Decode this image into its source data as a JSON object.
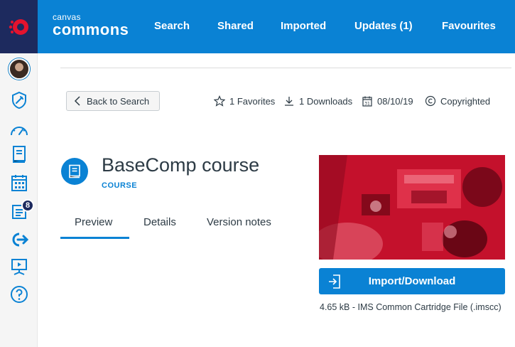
{
  "brand": {
    "small": "canvas",
    "big": "commons"
  },
  "nav": [
    {
      "label": "Search"
    },
    {
      "label": "Shared"
    },
    {
      "label": "Imported"
    },
    {
      "label": "Updates (1)"
    },
    {
      "label": "Favourites"
    }
  ],
  "sidebar": {
    "icons": [
      "avatar",
      "admin-icon",
      "dashboard-icon",
      "courses-icon",
      "calendar-icon",
      "inbox-icon",
      "commons-icon",
      "studio-icon",
      "help-icon"
    ],
    "inbox_badge": "8"
  },
  "back_button": {
    "label": "Back to Search"
  },
  "meta": {
    "favorites": "1 Favorites",
    "downloads": "1 Downloads",
    "date": "08/10/19",
    "license": "Copyrighted"
  },
  "resource": {
    "title": "BaseComp course",
    "type": "COURSE"
  },
  "tabs": [
    {
      "label": "Preview",
      "active": true
    },
    {
      "label": "Details"
    },
    {
      "label": "Version notes"
    }
  ],
  "import": {
    "label": "Import/Download"
  },
  "file_info": "4.65 kB - IMS Common Cartridge File (.imscc)",
  "colors": {
    "header": "#0a82d4",
    "logo_bg": "#1d2a5e",
    "accent": "#0a82d4",
    "thumbnail_tint": "#d8152f"
  }
}
